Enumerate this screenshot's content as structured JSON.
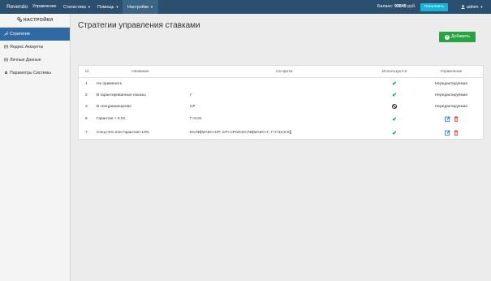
{
  "navbar": {
    "brand": "Revendo",
    "items": [
      {
        "label": "Управление",
        "caret": false,
        "active": false
      },
      {
        "label": "Статистика",
        "caret": true,
        "active": false
      },
      {
        "label": "Помощь",
        "caret": true,
        "active": false
      },
      {
        "label": "Настройки",
        "caret": true,
        "active": true
      }
    ],
    "balance_label": "Баланс:",
    "balance_value": "99849",
    "balance_currency": "руб.",
    "topup_label": "Пополнить",
    "user_name": "admin"
  },
  "sidebar": {
    "heading": "НАСТРОЙКИ",
    "items": [
      {
        "label": "Стратегии",
        "icon": "wrench-icon",
        "active": true
      },
      {
        "label": "Яндекс Аккаунты",
        "icon": "card-icon",
        "active": false
      },
      {
        "label": "Личные Данные",
        "icon": "id-card-icon",
        "active": false
      },
      {
        "label": "Параметры Системы",
        "icon": "gear-icon",
        "active": false
      }
    ]
  },
  "main": {
    "title": "Стратегии управления ставками",
    "add_label": "Добавить",
    "table": {
      "headers": {
        "id": "Id",
        "name": "Название",
        "algo": "Алгоритм",
        "used": "Используется",
        "manage": "Управление"
      },
      "rows": [
        {
          "id": "1",
          "name": "Не применять",
          "algo": "",
          "used": "check",
          "manage": "Нередактируемая"
        },
        {
          "id": "2",
          "name": "В гарантированные показы",
          "algo": "Г",
          "used": "check",
          "manage": "Нередактируемая"
        },
        {
          "id": "3",
          "name": "В спецразмещение",
          "algo": "СР",
          "used": "ban",
          "manage": "Нередактируемая"
        },
        {
          "id": "6",
          "name": "Гарантия + 0.01",
          "algo": "Г+0.01",
          "used": "check",
          "manage": "actions"
        },
        {
          "id": "7",
          "name": "Спец+5% или Гарантия+10%",
          "algo": "ЕСЛИ[МАКС<СР; СР+СР/20;ЕСЛИ[МАКС<Г; Г+Г/10;0.5]]",
          "used": "check",
          "manage": "actions"
        }
      ]
    }
  },
  "colors": {
    "navbar": "#2b4f6f",
    "active": "#2f6aa5",
    "success": "#26a442",
    "topup": "#1ab2d6",
    "check": "#1a9c4e",
    "danger": "#e0353d",
    "edit": "#2e7fc0"
  }
}
